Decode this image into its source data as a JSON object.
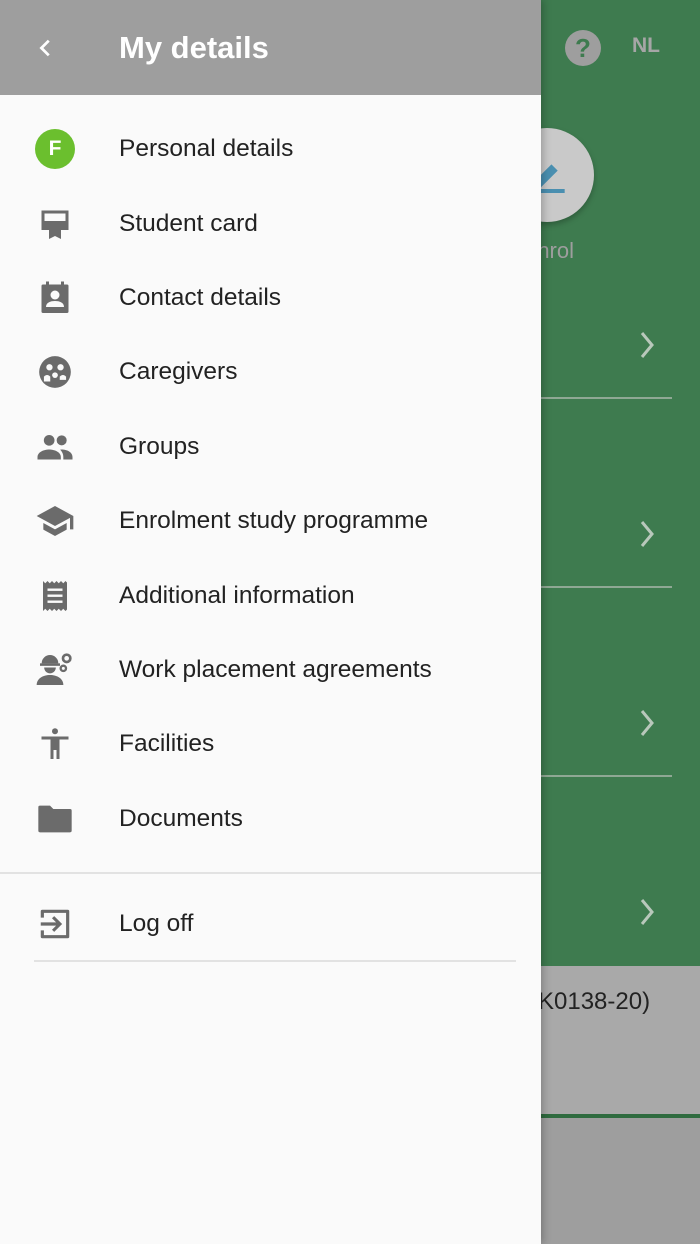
{
  "background": {
    "lang_label": "NL",
    "help_glyph": "?",
    "fab_label": "nrol",
    "footer_text": "K0138-20)",
    "accent": "#3e7b4f"
  },
  "drawer": {
    "title": "My details",
    "avatar_letter": "F",
    "items": [
      {
        "label": "Personal details",
        "icon": "avatar-icon"
      },
      {
        "label": "Student card",
        "icon": "card-icon"
      },
      {
        "label": "Contact details",
        "icon": "contact-icon"
      },
      {
        "label": "Caregivers",
        "icon": "caregivers-icon"
      },
      {
        "label": "Groups",
        "icon": "groups-icon"
      },
      {
        "label": "Enrolment study programme",
        "icon": "graduation-cap-icon"
      },
      {
        "label": "Additional information",
        "icon": "receipt-icon"
      },
      {
        "label": "Work placement agreements",
        "icon": "worker-icon"
      },
      {
        "label": "Facilities",
        "icon": "accessibility-icon"
      },
      {
        "label": "Documents",
        "icon": "folder-icon"
      }
    ],
    "logoff_label": "Log off"
  }
}
